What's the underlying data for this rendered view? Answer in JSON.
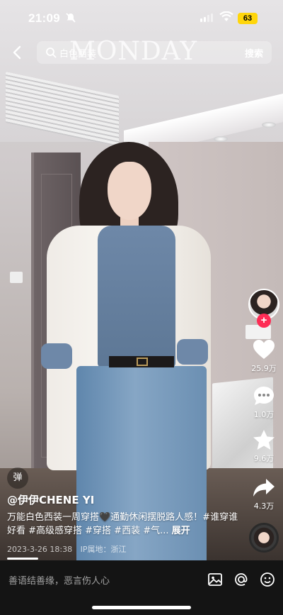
{
  "status_bar": {
    "time": "21:09",
    "battery": "63"
  },
  "search": {
    "query": "白色西装",
    "watermark": "MONDAY",
    "button": "搜索"
  },
  "actions": {
    "likes": "25.9万",
    "comments": "1.0万",
    "favorites": "9.6万",
    "shares": "4.3万",
    "follow": "+"
  },
  "video": {
    "danmu_label": "弹",
    "author": "@伊伊CHENE YI",
    "caption": "万能白色西装一周穿搭🖤通勤休闲摆脱路人感！#谁穿谁好看 #高级感穿搭 #穿搭 #西装 #气...",
    "expand": "展开",
    "date": "2023-3-26 18:38",
    "ip_location": "IP属地：浙江"
  },
  "bottom": {
    "comment_placeholder": "善语结善缘，恶言伤人心"
  },
  "colors": {
    "accent": "#fe2c55",
    "battery": "#ffd60a",
    "bar_bg": "#141414"
  },
  "icons": [
    "back-arrow-icon",
    "search-icon",
    "heart-icon",
    "comment-icon",
    "star-icon",
    "share-icon",
    "image-icon",
    "at-icon",
    "emoji-icon"
  ]
}
